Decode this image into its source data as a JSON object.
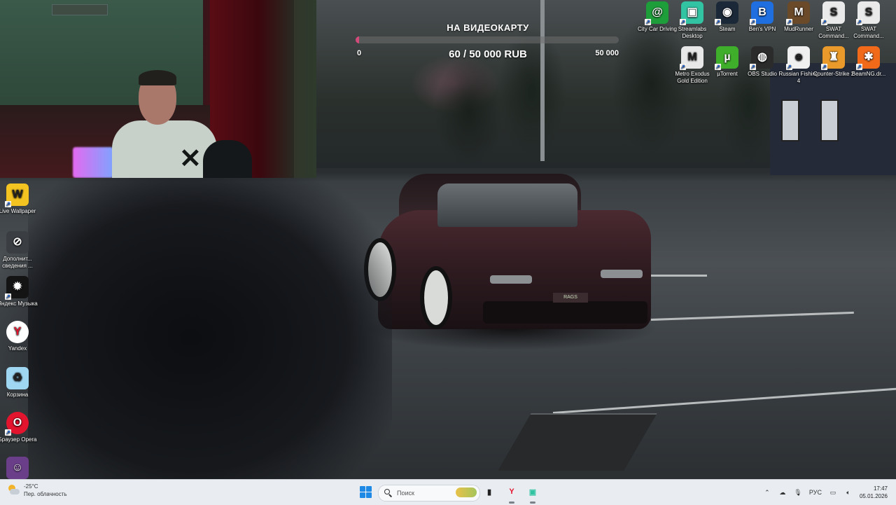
{
  "goal": {
    "title": "НА ВИДЕОКАРТУ",
    "min": "0",
    "max": "50 000",
    "progress_text": "60 / 50 000 RUB",
    "fraction": 0.0012,
    "fill_color": "#d24a7a"
  },
  "car_plate": "RAGS",
  "desktop_icons": [
    {
      "id": "city-car-driving",
      "label": "City Car Driving",
      "icon": "city-car-driving-icon",
      "color": "#1e9e3a",
      "glyph": "@",
      "shortcut": true
    },
    {
      "id": "streamlabs",
      "label": "Streamlabs Desktop",
      "icon": "streamlabs-icon",
      "color": "#31c3a2",
      "glyph": "▣",
      "shortcut": true
    },
    {
      "id": "steam",
      "label": "Steam",
      "icon": "steam-icon",
      "color": "#1b2838",
      "glyph": "◉",
      "shortcut": true
    },
    {
      "id": "bens-vpn",
      "label": "Ben's VPN",
      "icon": "bens-vpn-icon",
      "color": "#1f6fe0",
      "glyph": "B",
      "shortcut": true
    },
    {
      "id": "mudrunner",
      "label": "MudRunner",
      "icon": "mudrunner-icon",
      "color": "#6b4a2a",
      "glyph": "M",
      "shortcut": true
    },
    {
      "id": "swat-command-1",
      "label": "SWAT Command...",
      "icon": "swat-command-icon",
      "color": "#eaeaea",
      "glyph": "S",
      "shortcut": true
    },
    {
      "id": "swat-command-2",
      "label": "SWAT Command...",
      "icon": "swat-command-icon",
      "color": "#eaeaea",
      "glyph": "S",
      "shortcut": true
    },
    {
      "id": "metro-exodus",
      "label": "Metro Exodus Gold Edition",
      "icon": "metro-exodus-icon",
      "color": "#e8e8e8",
      "glyph": "M",
      "shortcut": true
    },
    {
      "id": "utorrent",
      "label": "µTorrent",
      "icon": "utorrent-icon",
      "color": "#3fae2a",
      "glyph": "µ",
      "shortcut": true
    },
    {
      "id": "obs-studio",
      "label": "OBS Studio",
      "icon": "obs-studio-icon",
      "color": "#2b2b2b",
      "glyph": "◍",
      "shortcut": true
    },
    {
      "id": "russian-fishing",
      "label": "Russian Fishing 4",
      "icon": "russian-fishing-icon",
      "color": "#f0f0f0",
      "glyph": "☻",
      "shortcut": true
    },
    {
      "id": "counter-strike",
      "label": "Counter-Strike 2",
      "icon": "counter-strike-icon",
      "color": "#e99a2a",
      "glyph": "♜",
      "shortcut": true
    },
    {
      "id": "beamng",
      "label": "BeamNG.dr...",
      "icon": "beamng-icon",
      "color": "#f06a1a",
      "glyph": "✱",
      "shortcut": true
    },
    {
      "id": "live-wallpaper",
      "label": "Live Wallpaper",
      "icon": "live-wallpaper-icon",
      "color": "#f3c321",
      "glyph": "W",
      "shortcut": true
    },
    {
      "id": "dopolnitelnye",
      "label": "Дополнит... сведения ...",
      "icon": "additional-info-icon",
      "color": "#3a3d42",
      "glyph": "⊘",
      "shortcut": false
    },
    {
      "id": "yandex-music",
      "label": "Яндекс Музыка",
      "icon": "yandex-music-icon",
      "color": "#141414",
      "glyph": "✹",
      "shortcut": true
    },
    {
      "id": "yandex",
      "label": "Yandex",
      "icon": "yandex-browser-icon",
      "color": "#ffffff",
      "glyph": "Y",
      "shortcut": false
    },
    {
      "id": "recycle-bin",
      "label": "Корзина",
      "icon": "recycle-bin-icon",
      "color": "#9fd6f2",
      "glyph": "♻",
      "shortcut": false
    },
    {
      "id": "opera",
      "label": "Браузер Opera",
      "icon": "opera-browser-icon",
      "color": "#e3142d",
      "glyph": "O",
      "shortcut": true
    },
    {
      "id": "user-app",
      "label": "",
      "icon": "app-avatar-icon",
      "color": "#6b3e8a",
      "glyph": "☺",
      "shortcut": false
    }
  ],
  "taskbar": {
    "weather_temp": "-25°C",
    "weather_desc": "Пер. облачность",
    "search_placeholder": "Поиск",
    "lang": "РУС",
    "time": "17:47",
    "date": "05.01.2026",
    "apps": [
      {
        "id": "task-view",
        "icon": "task-view-icon",
        "glyph": "▮",
        "color": "#222222"
      },
      {
        "id": "yandex",
        "icon": "yandex-browser-icon",
        "glyph": "Y",
        "color": "#e3142d"
      },
      {
        "id": "streamlabs",
        "icon": "streamlabs-icon",
        "glyph": "▣",
        "color": "#31c3a2"
      }
    ]
  }
}
